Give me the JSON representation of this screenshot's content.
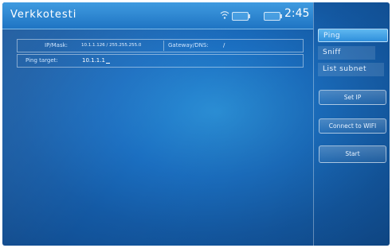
{
  "window": {
    "title": "Verkkotesti"
  },
  "status_bar": {
    "clock": "2:45",
    "icons": [
      "wifi-icon",
      "battery-icon",
      "battery-icon"
    ]
  },
  "form": {
    "ipmask_label": "IP/Mask:",
    "ipmask_value": "10.1.1.126 / 255.255.255.0",
    "gateway_label": "Gateway/DNS:",
    "gateway_value": "/",
    "ping_label": "Ping target:",
    "ping_value": "10.1.1.1"
  },
  "tabs": [
    {
      "label": "Ping",
      "active": true
    },
    {
      "label": "Sniff",
      "active": false
    },
    {
      "label": "List subnet",
      "active": false
    }
  ],
  "buttons": {
    "set_ip": "Set IP",
    "connect_wifi": "Connect to WIFI",
    "start": "Start"
  },
  "colors": {
    "background": "#1b6fc1",
    "active_tab": "#3f9be0",
    "text": "#e8f3ff"
  }
}
